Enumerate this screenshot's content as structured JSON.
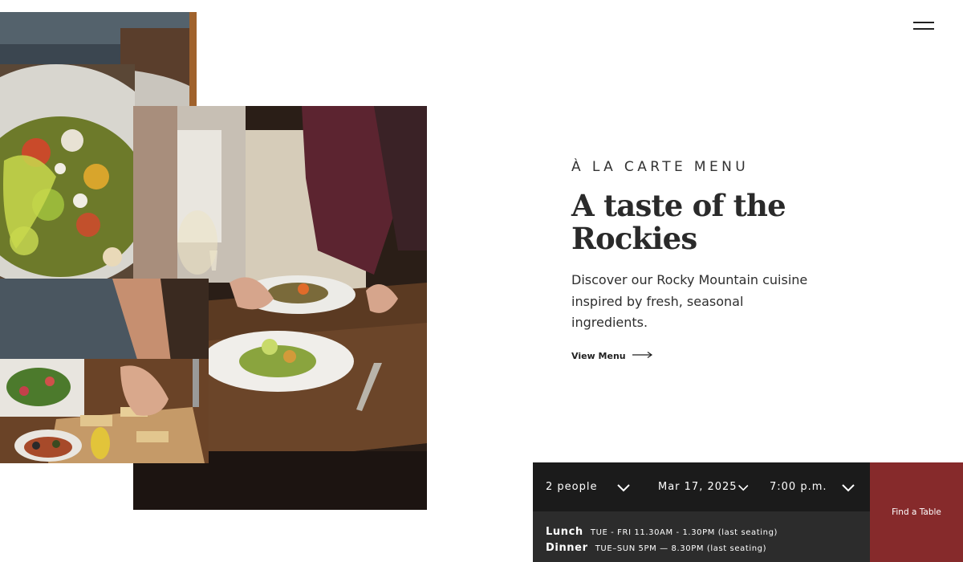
{
  "nav": {
    "menu_icon": "hamburger-icon"
  },
  "hero": {
    "eyebrow": "À LA CARTE MENU",
    "headline": "A taste of the Rockies",
    "description": "Discover our Rocky Mountain cuisine inspired by fresh, seasonal ingredients.",
    "cta_label": "View Menu",
    "cta_icon": "arrow-right-icon"
  },
  "photos": [
    {
      "name": "plated-salad-photo"
    },
    {
      "name": "diner-table-photo"
    },
    {
      "name": "server-plating-photo"
    },
    {
      "name": "appetizer-board-photo"
    }
  ],
  "reservation": {
    "party_size": "2 people",
    "date": "Mar 17, 2025",
    "time": "7:00 p.m.",
    "chevron_icon": "chevron-down-icon",
    "submit_label": "Find a Table",
    "hours": [
      {
        "label": "Lunch",
        "detail": "TUE - FRI 11.30AM - 1.30PM (last seating)"
      },
      {
        "label": "Dinner",
        "detail": "TUE–SUN 5PM — 8.30PM (last seating)"
      }
    ]
  },
  "colors": {
    "accent": "#862a2b",
    "bar_dark": "#1b1b1b",
    "bar_hours": "#2c2c2c",
    "text": "#2b2b2b"
  }
}
